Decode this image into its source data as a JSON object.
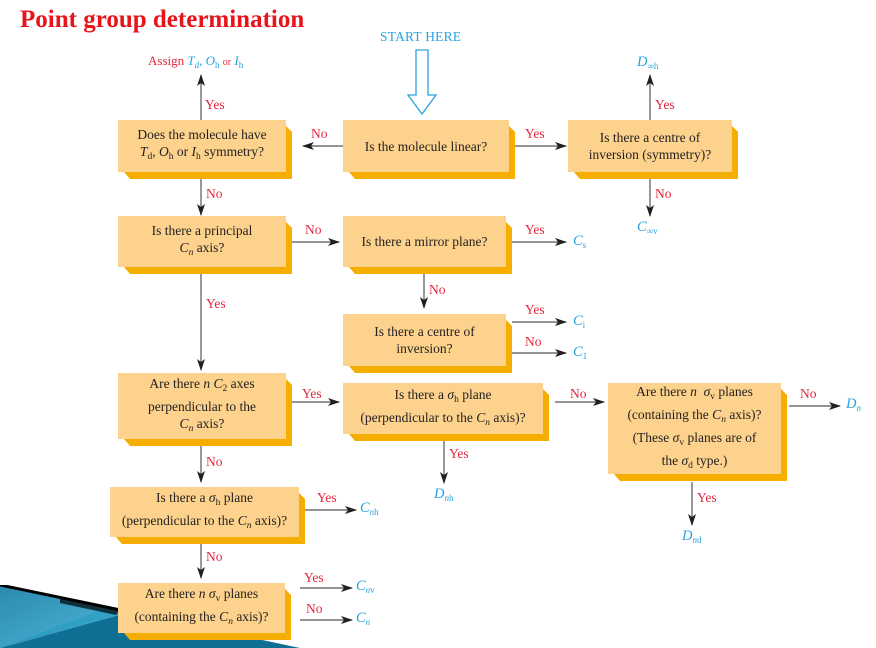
{
  "title": "Point group determination",
  "start_label": "START HERE",
  "colors": {
    "title": "#e8141b",
    "accent_blue": "#29a3de",
    "answer_red": "#e3263d",
    "box_fill": "#fcd28c",
    "box_shadow": "#f5ad00"
  },
  "assign": {
    "prefix": "Assign",
    "t": "T",
    "t_sub": "d",
    "o": "O",
    "o_sub": "h",
    "or": "or",
    "i": "I",
    "i_sub": "h"
  },
  "questions": {
    "linear": "Is the molecule linear?",
    "tdohih_line1": "Does the molecule have",
    "tdohih_line2_t": "T",
    "tdohih_line2_tsub": "d",
    "tdohih_line2_o": "O",
    "tdohih_line2_osub": "h",
    "tdohih_line2_or": " or ",
    "tdohih_line2_i": "I",
    "tdohih_line2_isub": "h",
    "tdohih_line2_end": " symmetry?",
    "centre_sym_line1": "Is there a centre of",
    "centre_sym_line2": "inversion (symmetry)?",
    "principal_line1": "Is there a principal",
    "principal_line2_c": "C",
    "principal_line2_n": "n",
    "principal_line2_end": " axis?",
    "mirror": "Is there a mirror plane?",
    "centre_line1": "Is there a centre of",
    "centre_line2": "inversion?",
    "c2axes_line1_a": "Are there ",
    "c2axes_line1_n": "n",
    "c2axes_line1_c": " C",
    "c2axes_line1_sub": "2",
    "c2axes_line1_end": " axes",
    "c2axes_line2": "perpendicular to the",
    "c2axes_line3_c": "C",
    "c2axes_line3_n": "n",
    "c2axes_line3_end": " axis?",
    "sigmah_line1_a": "Is there a ",
    "sigmah_line1_sigma": "σ",
    "sigmah_line1_sub": "h",
    "sigmah_line1_end": " plane",
    "sigmah_line2_a": "(perpendicular to the ",
    "sigmah_line2_c": "C",
    "sigmah_line2_n": "n",
    "sigmah_line2_end": " axis)?",
    "sigmad_line1_a": "Are there ",
    "sigmad_line1_n": "n",
    "sigmad_line1_sigma": "  σ",
    "sigmad_line1_sub": "v",
    "sigmad_line1_end": " planes",
    "sigmad_line2_a": "(containing the ",
    "sigmad_line2_c": "C",
    "sigmad_line2_n": "n",
    "sigmad_line2_end": " axis)?",
    "sigmad_line3_a": "(These ",
    "sigmad_line3_sigma": "σ",
    "sigmad_line3_sub": "v",
    "sigmad_line3_end": " planes are of",
    "sigmad_line4_a": "the ",
    "sigmad_line4_sigma": "σ",
    "sigmad_line4_sub": "d",
    "sigmad_line4_end": " type.)",
    "sigmav_line1_a": "Are there ",
    "sigmav_line1_n": "n",
    "sigmav_line1_sigma": " σ",
    "sigmav_line1_sub": "v",
    "sigmav_line1_end": " planes",
    "sigmav_line2_a": "(containing the ",
    "sigmav_line2_c": "C",
    "sigmav_line2_n": "n",
    "sigmav_line2_end": " axis)?"
  },
  "labels": {
    "yes": "Yes",
    "no": "No"
  },
  "results": {
    "D_inf_h": {
      "main": "D",
      "sub": "∞h"
    },
    "C_inf_v": {
      "main": "C",
      "sub": "∞v"
    },
    "Cs": {
      "main": "C",
      "sub": "s"
    },
    "Ci": {
      "main": "C",
      "sub": "i"
    },
    "C1": {
      "main": "C",
      "sub": "1"
    },
    "Dn": {
      "main": "D",
      "sub": "n"
    },
    "Dnh": {
      "main": "D",
      "sub_n": "n",
      "sub_rest": "h"
    },
    "Dnd": {
      "main": "D",
      "sub_n": "n",
      "sub_rest": "d"
    },
    "Cnh": {
      "main": "C",
      "sub_n": "n",
      "sub_rest": "h"
    },
    "Cnv": {
      "main": "C",
      "sub_n": "n",
      "sub_rest": "v"
    },
    "Cn": {
      "main": "C",
      "sub": "n"
    }
  }
}
